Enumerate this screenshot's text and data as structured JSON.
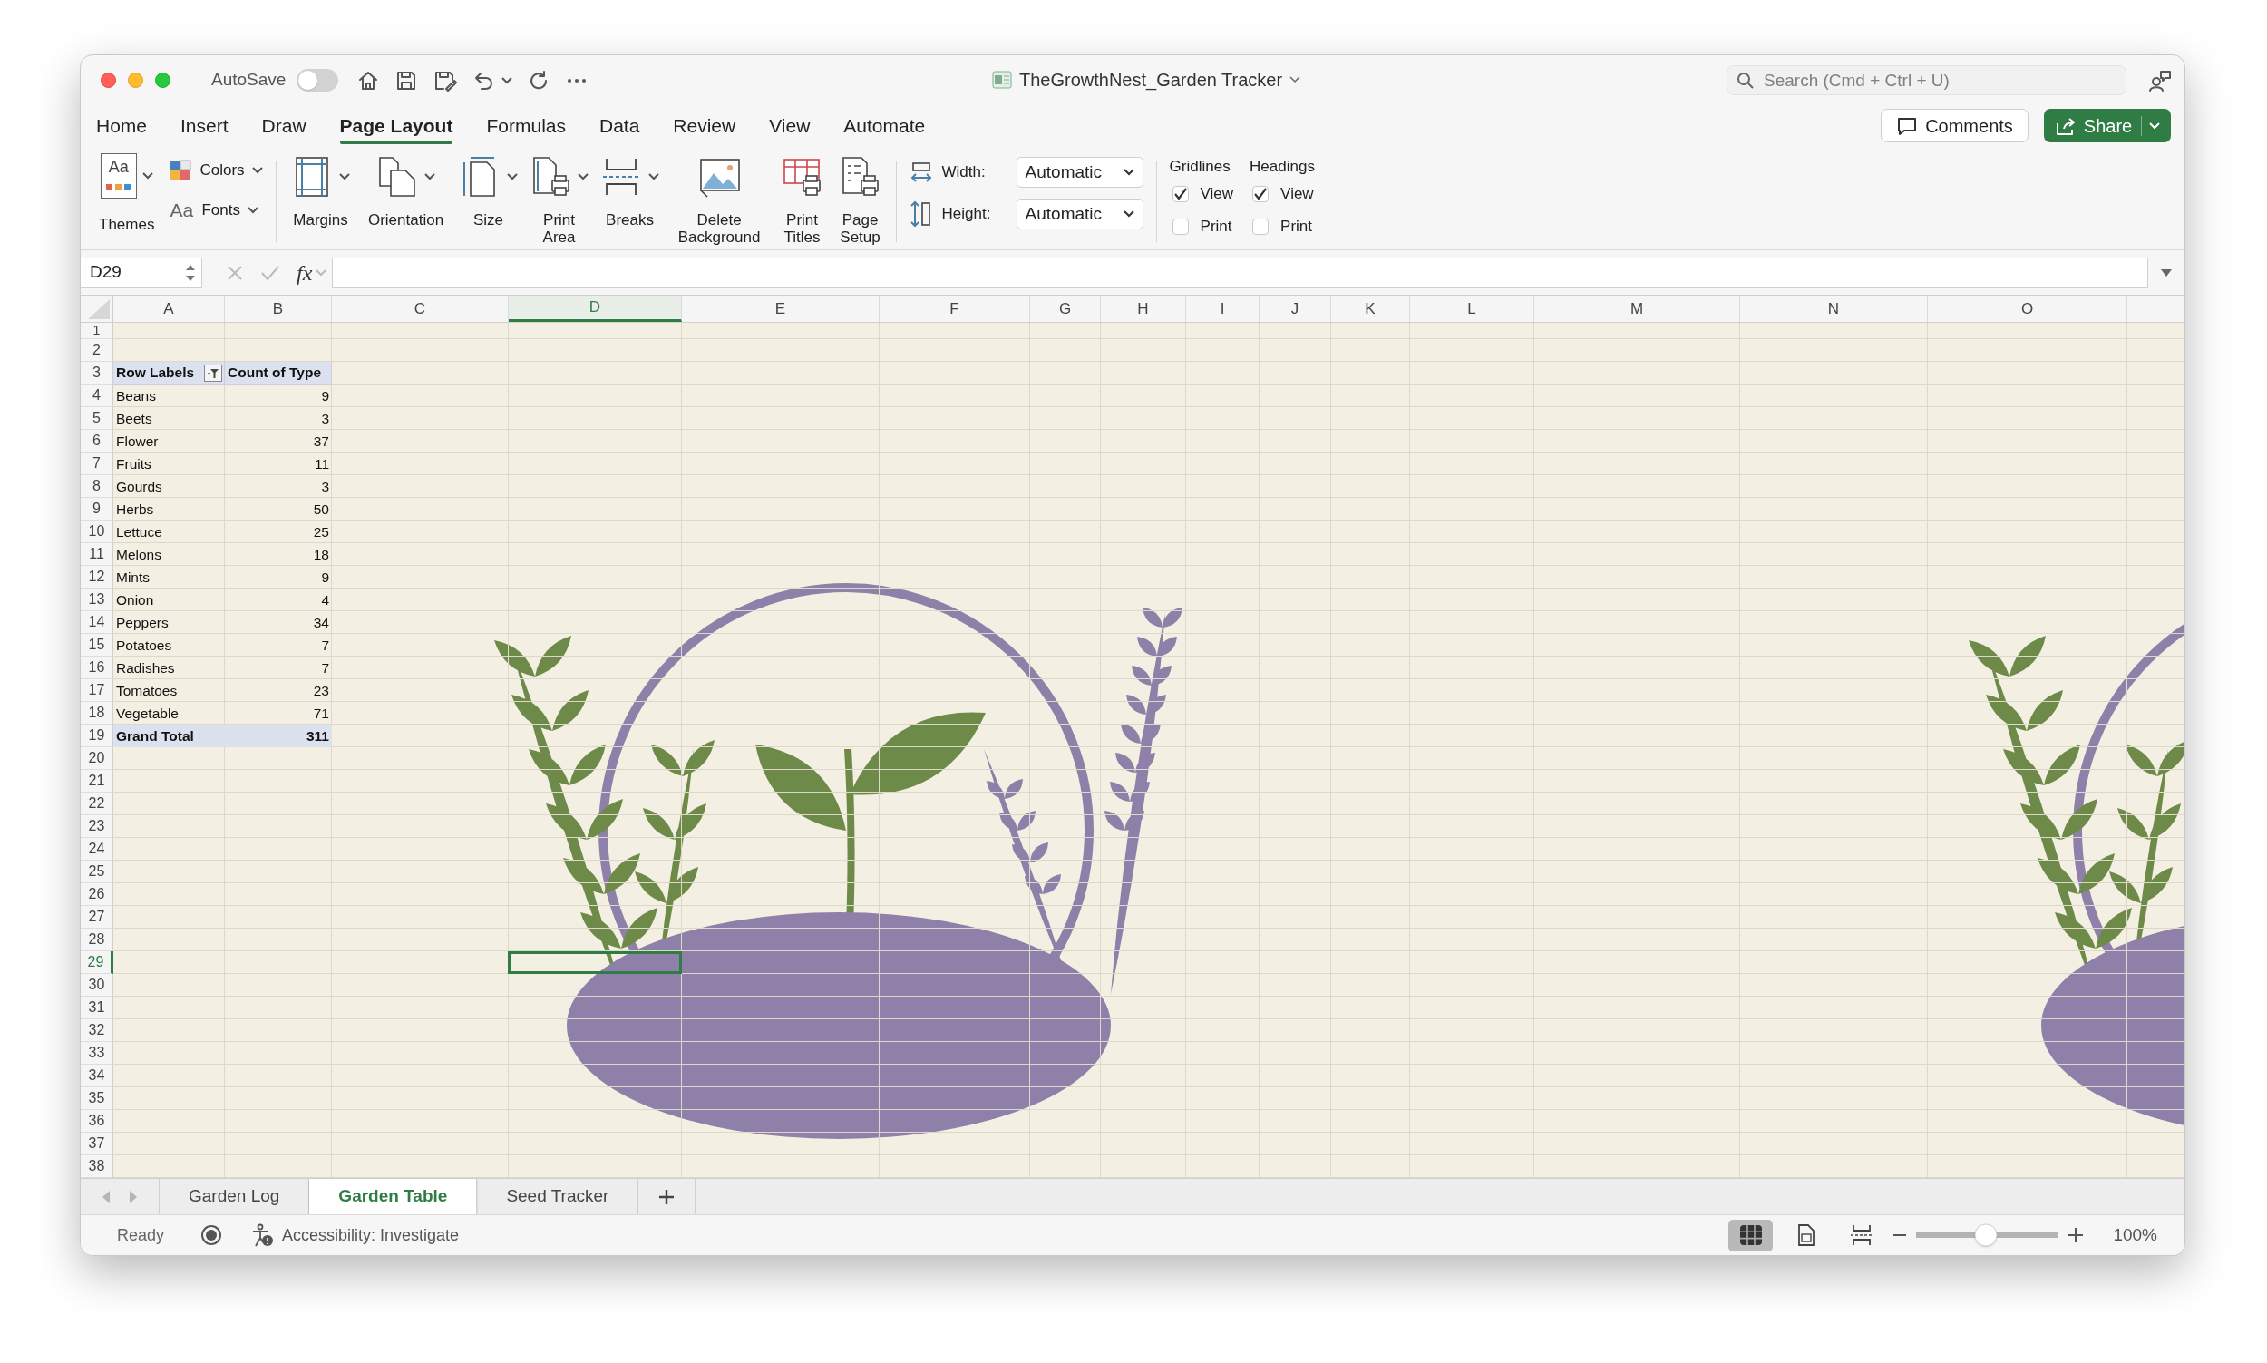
{
  "window": {
    "title": "TheGrowthNest_Garden Tracker",
    "autosave": {
      "label": "AutoSave",
      "on": false
    }
  },
  "search": {
    "placeholder": "Search (Cmd + Ctrl + U)"
  },
  "tabs": [
    {
      "label": "Home",
      "selected": false
    },
    {
      "label": "Insert",
      "selected": false
    },
    {
      "label": "Draw",
      "selected": false
    },
    {
      "label": "Page Layout",
      "selected": true
    },
    {
      "label": "Formulas",
      "selected": false
    },
    {
      "label": "Data",
      "selected": false
    },
    {
      "label": "Review",
      "selected": false
    },
    {
      "label": "View",
      "selected": false
    },
    {
      "label": "Automate",
      "selected": false
    }
  ],
  "actions": {
    "comments": "Comments",
    "share": "Share"
  },
  "ribbon": {
    "theme_group": [
      {
        "kind": "large",
        "label": "Themes",
        "glyph": "Aa",
        "has_menu": true
      },
      {
        "kind": "small",
        "label": "Colors",
        "has_menu": true
      },
      {
        "kind": "small",
        "label": "Fonts",
        "glyph": "Aa",
        "has_menu": true
      }
    ],
    "page_setup": [
      {
        "label": "Margins",
        "has_menu": true
      },
      {
        "label": "Orientation",
        "has_menu": true
      },
      {
        "label": "Size",
        "has_menu": true
      },
      {
        "label": "Print Area",
        "has_menu": true
      },
      {
        "label": "Breaks",
        "has_menu": true
      },
      {
        "label": "Delete Background",
        "has_menu": false
      },
      {
        "label": "Print Titles",
        "has_menu": false
      },
      {
        "label": "Page Setup",
        "has_menu": false
      }
    ],
    "scale": [
      {
        "label": "Width:",
        "value": "Automatic"
      },
      {
        "label": "Height:",
        "value": "Automatic"
      }
    ],
    "sheet_options": [
      {
        "title": "Gridlines",
        "options": [
          {
            "label": "View",
            "checked": true
          },
          {
            "label": "Print",
            "checked": false
          }
        ]
      },
      {
        "title": "Headings",
        "options": [
          {
            "label": "View",
            "checked": true
          },
          {
            "label": "Print",
            "checked": false
          }
        ]
      }
    ]
  },
  "formula_bar": {
    "name_box": "D29",
    "fx": "fx"
  },
  "columns": [
    {
      "label": "A",
      "selected": false
    },
    {
      "label": "B",
      "selected": false
    },
    {
      "label": "C",
      "selected": false
    },
    {
      "label": "D",
      "selected": true
    },
    {
      "label": "E",
      "selected": false
    },
    {
      "label": "F",
      "selected": false
    },
    {
      "label": "G",
      "selected": false
    },
    {
      "label": "H",
      "selected": false
    },
    {
      "label": "I",
      "selected": false
    },
    {
      "label": "J",
      "selected": false
    },
    {
      "label": "K",
      "selected": false
    },
    {
      "label": "L",
      "selected": false
    },
    {
      "label": "M",
      "selected": false
    },
    {
      "label": "N",
      "selected": false
    },
    {
      "label": "O",
      "selected": false
    }
  ],
  "rows": [
    {
      "label": "1",
      "selected": false
    },
    {
      "label": "2",
      "selected": false
    },
    {
      "label": "3",
      "selected": false
    },
    {
      "label": "4",
      "selected": false
    },
    {
      "label": "5",
      "selected": false
    },
    {
      "label": "6",
      "selected": false
    },
    {
      "label": "7",
      "selected": false
    },
    {
      "label": "8",
      "selected": false
    },
    {
      "label": "9",
      "selected": false
    },
    {
      "label": "10",
      "selected": false
    },
    {
      "label": "11",
      "selected": false
    },
    {
      "label": "12",
      "selected": false
    },
    {
      "label": "13",
      "selected": false
    },
    {
      "label": "14",
      "selected": false
    },
    {
      "label": "15",
      "selected": false
    },
    {
      "label": "16",
      "selected": false
    },
    {
      "label": "17",
      "selected": false
    },
    {
      "label": "18",
      "selected": false
    },
    {
      "label": "19",
      "selected": false
    },
    {
      "label": "20",
      "selected": false
    },
    {
      "label": "21",
      "selected": false
    },
    {
      "label": "22",
      "selected": false
    },
    {
      "label": "23",
      "selected": false
    },
    {
      "label": "24",
      "selected": false
    },
    {
      "label": "25",
      "selected": false
    },
    {
      "label": "26",
      "selected": false
    },
    {
      "label": "27",
      "selected": false
    },
    {
      "label": "28",
      "selected": false
    },
    {
      "label": "29",
      "selected": true
    },
    {
      "label": "30",
      "selected": false
    },
    {
      "label": "31",
      "selected": false
    },
    {
      "label": "32",
      "selected": false
    },
    {
      "label": "33",
      "selected": false
    },
    {
      "label": "34",
      "selected": false
    },
    {
      "label": "35",
      "selected": false
    },
    {
      "label": "36",
      "selected": false
    },
    {
      "label": "37",
      "selected": false
    },
    {
      "label": "38",
      "selected": false
    }
  ],
  "pivot": {
    "row_labels": "Row Labels",
    "value_header": "Count of Type",
    "rows": [
      {
        "label": "Beans",
        "count": "9"
      },
      {
        "label": "Beets",
        "count": "3"
      },
      {
        "label": "Flower",
        "count": "37"
      },
      {
        "label": "Fruits",
        "count": "11"
      },
      {
        "label": "Gourds",
        "count": "3"
      },
      {
        "label": "Herbs",
        "count": "50"
      },
      {
        "label": "Lettuce",
        "count": "25"
      },
      {
        "label": "Melons",
        "count": "18"
      },
      {
        "label": "Mints",
        "count": "9"
      },
      {
        "label": "Onion",
        "count": "4"
      },
      {
        "label": "Peppers",
        "count": "34"
      },
      {
        "label": "Potatoes",
        "count": "7"
      },
      {
        "label": "Radishes",
        "count": "7"
      },
      {
        "label": "Tomatoes",
        "count": "23"
      },
      {
        "label": "Vegetable",
        "count": "71"
      }
    ],
    "total": {
      "label": "Grand Total",
      "count": "311"
    }
  },
  "sheet_tabs": [
    {
      "label": "Garden Log",
      "selected": false
    },
    {
      "label": "Garden Table",
      "selected": true
    },
    {
      "label": "Seed Tracker",
      "selected": false
    }
  ],
  "status_bar": {
    "ready": "Ready",
    "accessibility": "Accessibility: Investigate",
    "views": [
      {
        "selected": true
      },
      {
        "selected": false
      },
      {
        "selected": false
      }
    ],
    "zoom": {
      "level": 0.49,
      "reading": "100%"
    }
  }
}
